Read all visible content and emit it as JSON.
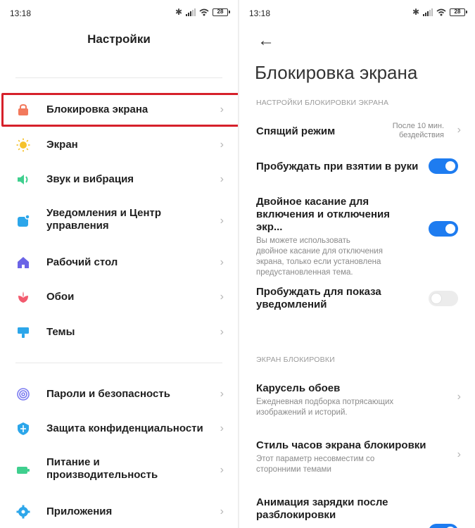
{
  "left": {
    "status": {
      "time": "13:18",
      "battery": "28"
    },
    "title": "Настройки",
    "items": [
      {
        "label": "Блокировка экрана",
        "icon": "lock-icon"
      },
      {
        "label": "Экран",
        "icon": "sun-icon"
      },
      {
        "label": "Звук и вибрация",
        "icon": "speaker-icon"
      },
      {
        "label": "Уведомления и Центр управления",
        "icon": "notification-icon"
      },
      {
        "label": "Рабочий стол",
        "icon": "home-icon"
      },
      {
        "label": "Обои",
        "icon": "flower-icon"
      },
      {
        "label": "Темы",
        "icon": "brush-icon"
      },
      {
        "label": "Пароли и безопасность",
        "icon": "fingerprint-icon"
      },
      {
        "label": "Защита конфиденциальности",
        "icon": "shield-icon"
      },
      {
        "label": "Питание и производительность",
        "icon": "battery-icon"
      },
      {
        "label": "Приложения",
        "icon": "gear-icon"
      }
    ]
  },
  "right": {
    "status": {
      "time": "13:18",
      "battery": "28"
    },
    "title": "Блокировка экрана",
    "section1": "НАСТРОЙКИ БЛОКИРОВКИ ЭКРАНА",
    "sleep": {
      "title": "Спящий режим",
      "value_line1": "После 10 мин.",
      "value_line2": "бездействия"
    },
    "wake_on_lift": {
      "title": "Пробуждать при взятии в руки",
      "enabled": true
    },
    "double_tap": {
      "title_line1": "Двойное касание для",
      "title_line2": "включения и отключения экр...",
      "sub1": "Вы можете использовать",
      "sub2": "двойное касание для отключения",
      "sub3": "экрана, только если установлена",
      "sub4": "предустановленная тема.",
      "enabled": true
    },
    "wake_notifications": {
      "title_line1": "Пробуждать для показа",
      "title_line2": "уведомлений",
      "enabled": false
    },
    "section2": "ЭКРАН БЛОКИРОВКИ",
    "carousel": {
      "title": "Карусель обоев",
      "sub1": "Ежедневная подборка потрясающих",
      "sub2": "изображений и историй."
    },
    "clock_style": {
      "title": "Стиль часов экрана блокировки",
      "sub1": "Этот параметр несовместим со",
      "sub2": "сторонними темами"
    },
    "charge_anim": {
      "title_line1": "Анимация зарядки после",
      "title_line2": "разблокировки"
    }
  },
  "colors": {
    "accent": "#1e7cf0",
    "highlight": "#d6202a"
  }
}
